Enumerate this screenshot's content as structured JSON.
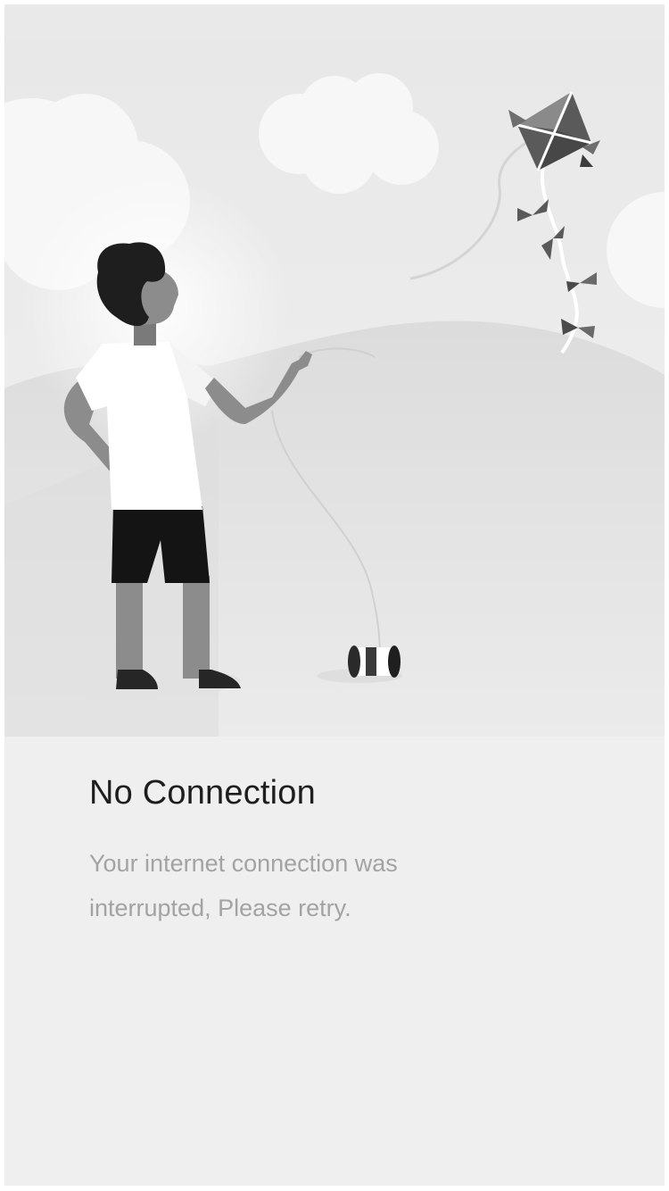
{
  "error_screen": {
    "title": "No Connection",
    "message": "Your internet connection was interrupted, Please retry."
  },
  "illustration": {
    "subject": "boy-flying-kite",
    "icons": [
      "cloud-icon",
      "kite-icon",
      "string-spool-icon",
      "hill-icon"
    ]
  },
  "colors": {
    "background": "#efefef",
    "status_bar": "#e9e9e9",
    "title_text": "#1e1e1e",
    "body_text": "#a3a3a3"
  }
}
